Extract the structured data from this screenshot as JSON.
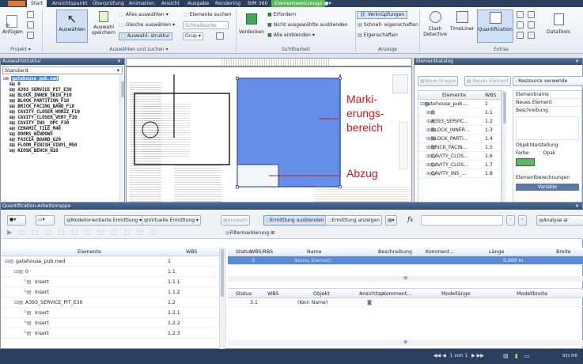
{
  "ribbon_tabs": [
    "Start",
    "Ansichtspunkt",
    "Überprüfung",
    "Animation",
    "Ansicht",
    "Ausgabe",
    "Rendering",
    "BIM 360",
    "Elementwerkzeuge"
  ],
  "ribbon": {
    "anfuegen": "Anfügen",
    "auswaehlen": "Auswählen",
    "auswahl_speichern_1": "Auswahl",
    "auswahl_speichern_2": "speichern",
    "alles_auswaehlen": "Alles auswählen",
    "gleiche_auswaehlen": "Gleiche auswählen",
    "auswahlstruktur": "Auswahl- struktur",
    "schnellsuche_placeholder": "Schnellsuche",
    "elemente_suchen": "Elemente suchen",
    "grup": "Grup",
    "verdecken": "Verdecken",
    "erfordern": "Erfordern",
    "nicht_ausgewaehlte_ausblenden": "Nicht ausgewählte ausblenden",
    "alle_einblenden": "Alle einblenden",
    "verknuepfungen": "Verknüpfungen",
    "schnell_eigenschaften": "Schnell- eigenschaften",
    "eigenschaften": "Eigenschaften",
    "clash_1": "Clash",
    "clash_2": "Detective",
    "timeliner": "TimeLiner",
    "quantification": "Quantification",
    "datatools": "DataTools",
    "group_projekt": "Projekt",
    "group_auswaehlen": "Auswählen und suchen",
    "group_sichtbarkeit": "Sichtbarkeit",
    "group_anzeige": "Anzeige",
    "group_extras": "Extras"
  },
  "selection_tree": {
    "title": "Auswahlstruktur",
    "mode": "Standard",
    "items": [
      "gatehouse_pub.nwd",
      "0",
      "A393_SERVICE_PIT_E30",
      "BLOCK_INNER_SKIN_F10",
      "BLOCK_PARTITION_F10",
      "BRICK_FACING_BAND_F10",
      "CAVITY_CLOSER_HORIZ_F10",
      "CAVITY_CLOSER_VERT_F10",
      "CAVITY_INS__DPC_F30",
      "CERAMIC_TILE_M40",
      "DOORS_WINDOWS",
      "FASCIA_BOARD_G20",
      "FLOOR_FINISH_VINYL_M50",
      "KIOSK_BENCH_N10"
    ]
  },
  "annotations": {
    "markup_1": "Marki-",
    "markup_2": "erungs-",
    "markup_3": "bereich",
    "deduction": "Abzug"
  },
  "catalog": {
    "title": "Elementkatalog",
    "new_group": "Neue Gruppe",
    "new_element": "Neues Element",
    "resource": "Ressource verwende",
    "col_elements": "Elemente",
    "col_wbs": "WBS",
    "rows": [
      {
        "name": "gatehouse_pub....",
        "wbs": "1"
      },
      {
        "name": "0",
        "wbs": "1.1"
      },
      {
        "name": "A393_SERVIC...",
        "wbs": "1.2"
      },
      {
        "name": "BLOCK_INNER...",
        "wbs": "1.3"
      },
      {
        "name": "BLOCK_PARTI...",
        "wbs": "1.4"
      },
      {
        "name": "BRICK_FACIN...",
        "wbs": "1.5"
      },
      {
        "name": "CAVITY_CLOS...",
        "wbs": "1.6"
      },
      {
        "name": "CAVITY_CLOS...",
        "wbs": "1.7"
      },
      {
        "name": "CAVITY_INS_...",
        "wbs": "1.8"
      }
    ],
    "props": {
      "elementname": "Elementname",
      "neues_element": "Neues Element",
      "beschreibung": "Beschreibung",
      "objektdarstellung": "Objektdarstellung",
      "farbe": "Farbe",
      "opak": "Opak",
      "elementberechnungen": "Elementberechnungen",
      "variable": "Variable"
    },
    "color_swatch": "#5cb85c"
  },
  "workbook": {
    "title": "Quantification-Arbeitsmappe",
    "model_takeoff": "Modellorientierte Ermittlung",
    "virtual_takeoff": "Virtuelle Ermittlung",
    "auswahl": "Auswahl",
    "hide_takeoff": "Ermittlung ausblenden",
    "show_takeoff": "Ermittlung anzeigen",
    "analyse": "Analyse ar",
    "filter": "Filtermarkierung",
    "fx": "fx",
    "left_cols": [
      "Elemente",
      "WBS"
    ],
    "left_rows": [
      {
        "name": "gatehouse_pub.nwd",
        "wbs": "1",
        "level": 0
      },
      {
        "name": "0",
        "wbs": "1.1",
        "level": 1
      },
      {
        "name": "Insert",
        "wbs": "1.1.1",
        "level": 2
      },
      {
        "name": "Insert",
        "wbs": "1.1.2",
        "level": 2
      },
      {
        "name": "A393_SERVICE_PIT_E30",
        "wbs": "1.2",
        "level": 1
      },
      {
        "name": "Insert",
        "wbs": "1.2.1",
        "level": 2
      },
      {
        "name": "Insert",
        "wbs": "1.2.2",
        "level": 2
      },
      {
        "name": "Insert",
        "wbs": "1.2.3",
        "level": 2
      }
    ],
    "top_cols": [
      "Status",
      "WBS/RBS",
      "Name",
      "Beschreibung",
      "Komment...",
      "Länge",
      "Breite"
    ],
    "top_row": {
      "wbs": "3",
      "name": "Neues Element",
      "laenge": "0,000 m"
    },
    "bottom_cols": [
      "Status",
      "WBS",
      "Objekt",
      "Ansichtsp...",
      "Komment...",
      "Modellänge",
      "Modellbreite"
    ],
    "bottom_row": {
      "wbs": "3.1",
      "objekt": "(Kein Name)"
    },
    "scroll_mark": "III"
  },
  "statusbar": {
    "page": "1 von 1",
    "memory": "931 MB"
  }
}
